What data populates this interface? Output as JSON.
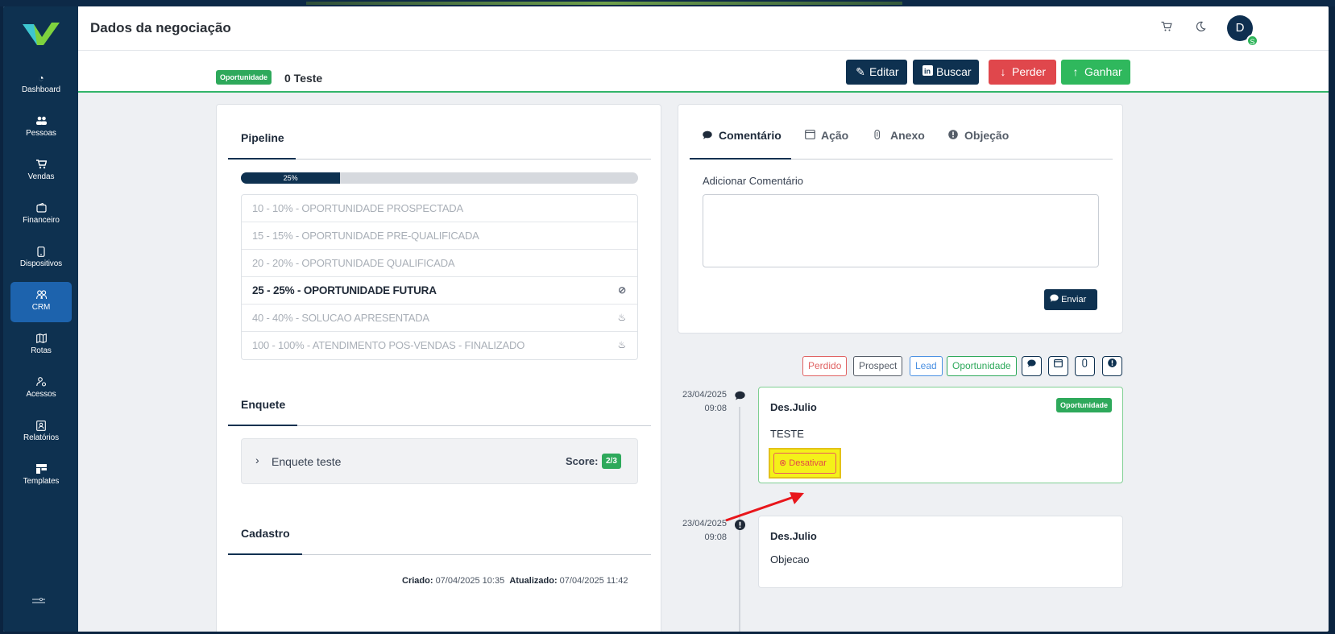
{
  "sidebar": {
    "items": [
      {
        "label": "Dashboard",
        "icon": "gauge-icon"
      },
      {
        "label": "Pessoas",
        "icon": "people-icon"
      },
      {
        "label": "Vendas",
        "icon": "cart-icon"
      },
      {
        "label": "Financeiro",
        "icon": "wallet-icon"
      },
      {
        "label": "Dispositivos",
        "icon": "phone-icon"
      },
      {
        "label": "CRM",
        "icon": "users-icon"
      },
      {
        "label": "Rotas",
        "icon": "map-icon"
      },
      {
        "label": "Acessos",
        "icon": "user-gear-icon"
      },
      {
        "label": "Relatórios",
        "icon": "report-icon"
      },
      {
        "label": "Templates",
        "icon": "template-icon"
      }
    ],
    "active": "CRM"
  },
  "header": {
    "title": "Dados da negociação",
    "avatar_letter": "D",
    "avatar_badge": "S"
  },
  "toolbar": {
    "status_badge": "Oportunidade",
    "deal_name": "0 Teste",
    "edit_label": "Editar",
    "search_label": "Buscar",
    "lose_label": "Perder",
    "win_label": "Ganhar"
  },
  "pipeline": {
    "title": "Pipeline",
    "progress_label": "25%",
    "progress": 0.25,
    "stages": [
      {
        "label": "10 - 10% - OPORTUNIDADE PROSPECTADA",
        "state": "done"
      },
      {
        "label": "15 - 15% - OPORTUNIDADE PRE-QUALIFICADA",
        "state": "done"
      },
      {
        "label": "20 - 20% - OPORTUNIDADE QUALIFICADA",
        "state": "done"
      },
      {
        "label": "25 - 25% - OPORTUNIDADE FUTURA",
        "state": "current"
      },
      {
        "label": "40 - 40% - SOLUCAO APRESENTADA",
        "state": "future"
      },
      {
        "label": "100 - 100% - ATENDIMENTO POS-VENDAS - FINALIZADO",
        "state": "future"
      }
    ]
  },
  "enquete": {
    "title": "Enquete",
    "item_name": "Enquete teste",
    "score_label": "Score:",
    "score_value": "2/3"
  },
  "cadastro": {
    "title": "Cadastro",
    "created_label": "Criado:",
    "created_value": "07/04/2025 10:35",
    "updated_label": "Atualizado:",
    "updated_value": "07/04/2025 11:42"
  },
  "activity": {
    "tabs": [
      {
        "label": "Comentário",
        "icon": "comment-icon",
        "active": true
      },
      {
        "label": "Ação",
        "icon": "calendar-icon",
        "active": false
      },
      {
        "label": "Anexo",
        "icon": "paperclip-icon",
        "active": false
      },
      {
        "label": "Objeção",
        "icon": "alert-icon",
        "active": false
      }
    ],
    "comment_label": "Adicionar Comentário",
    "comment_value": "",
    "send_label": "Enviar"
  },
  "filters": {
    "chips": [
      {
        "label": "Perdido",
        "color": "#e06262"
      },
      {
        "label": "Prospect",
        "color": "#555d68"
      },
      {
        "label": "Lead",
        "color": "#4a90e2"
      },
      {
        "label": "Oportunidade",
        "color": "#2ea95b"
      }
    ]
  },
  "timeline": [
    {
      "date": "23/04/2025",
      "time": "09:08",
      "icon": "comment-icon",
      "author": "Des.Julio",
      "text": "TESTE",
      "badge": "Oportunidade",
      "action_label": "Desativar"
    },
    {
      "date": "23/04/2025",
      "time": "09:08",
      "icon": "alert-icon",
      "author": "Des.Julio",
      "text": "Objecao"
    }
  ],
  "colors": {
    "brand_dark": "#0e3150",
    "accent_green": "#2fb85d",
    "danger": "#e0474c",
    "highlight": "#f4f119",
    "arrow": "#e8161b"
  }
}
